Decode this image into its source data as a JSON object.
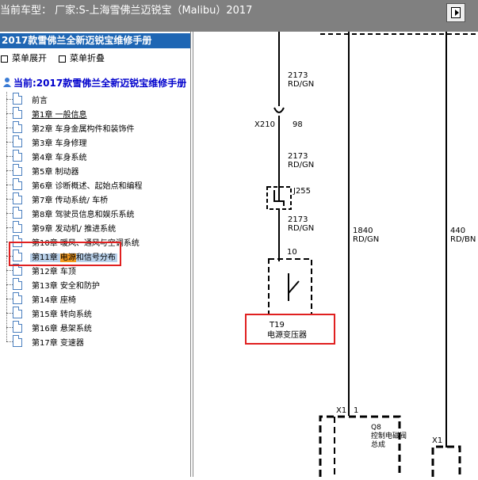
{
  "window": {
    "title": "当前车型：  厂家:S-上海雪佛兰迈锐宝（Malibu）2017"
  },
  "left_panel": {
    "manual_title": "2017款雪佛兰全新迈锐宝维修手册",
    "expand_label": "菜单展开",
    "collapse_label": "菜单折叠",
    "current_label": "当前:2017款雪佛兰全新迈锐宝维修手册",
    "items": [
      {
        "label": "前言"
      },
      {
        "label": "第1章 一般信息"
      },
      {
        "label": "第2章 车身金属构件和装饰件"
      },
      {
        "label": "第3章 车身修理"
      },
      {
        "label": "第4章 车身系统"
      },
      {
        "label": "第5章 制动器"
      },
      {
        "label": "第6章 诊断概述、起始点和编程"
      },
      {
        "label": "第7章 传动系统/ 车桥"
      },
      {
        "label": "第8章 驾驶员信息和娱乐系统"
      },
      {
        "label": "第9章 发动机/ 推进系统"
      },
      {
        "label": "第10章 暖风、通风与空调系统"
      },
      {
        "label_prefix": "第11章 ",
        "label_hl": "电源",
        "label_suffix": "和信号分布"
      },
      {
        "label": "第12章 车顶"
      },
      {
        "label": "第13章 安全和防护"
      },
      {
        "label": "第14章 座椅"
      },
      {
        "label": "第15章 转向系统"
      },
      {
        "label": "第16章 悬架系统"
      },
      {
        "label": "第17章 变速器"
      }
    ]
  },
  "diagram": {
    "wire1_top": {
      "circuit": "2173",
      "color": "RD/GN"
    },
    "connector_x210": {
      "name": "X210",
      "pin": "98"
    },
    "wire1_mid": {
      "circuit": "2173",
      "color": "RD/GN"
    },
    "splice": {
      "name": "J255"
    },
    "wire1_low": {
      "circuit": "2173",
      "color": "RD/GN"
    },
    "t19_pin": "10",
    "t19_name": "T19",
    "t19_desc": "电源变压器",
    "wire2": {
      "circuit": "1840",
      "color": "RD/GN"
    },
    "wire3": {
      "circuit": "440",
      "color": "RD/BN"
    },
    "x1_a": {
      "name": "X1",
      "pin": "1"
    },
    "q8_name": "Q8",
    "q8_desc_line1": "控制电磁阀",
    "q8_desc_line2": "总成",
    "x1_b": {
      "name": "X1"
    }
  }
}
